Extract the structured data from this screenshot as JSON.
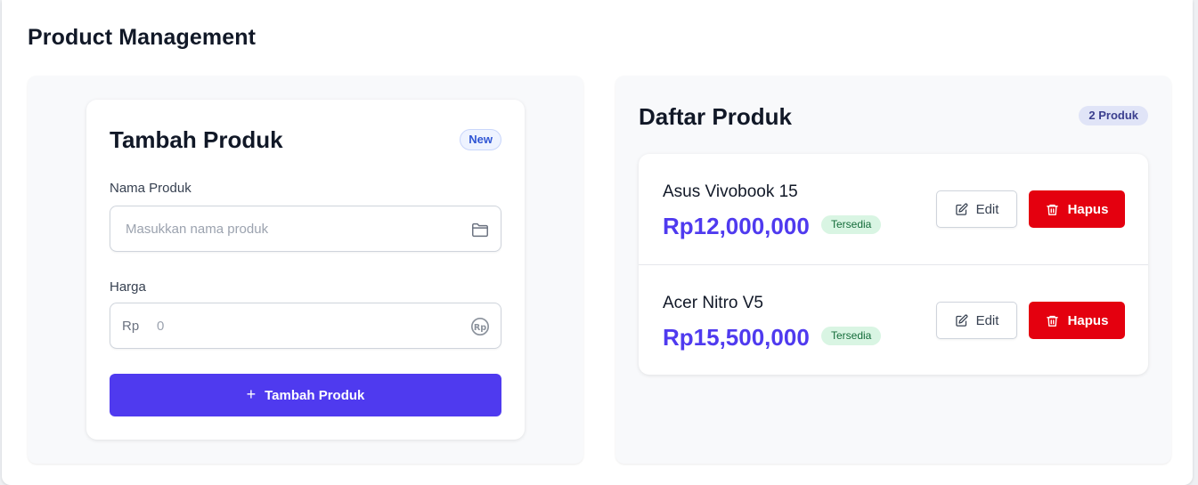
{
  "page": {
    "title": "Product Management"
  },
  "form": {
    "title": "Tambah Produk",
    "badge": "New",
    "name_label": "Nama Produk",
    "name_placeholder": "Masukkan nama produk",
    "name_value": "",
    "name_icon": "folder-icon",
    "price_label": "Harga",
    "price_prefix": "Rp",
    "price_placeholder": "0",
    "price_value": "",
    "price_icon": "rupiah-icon",
    "submit_label": "Tambah Produk",
    "submit_icon": "plus-icon"
  },
  "list": {
    "title": "Daftar Produk",
    "count_badge": "2 Produk",
    "items": [
      {
        "name": "Asus Vivobook 15",
        "price": "Rp12,000,000",
        "status": "Tersedia",
        "edit_label": "Edit",
        "delete_label": "Hapus"
      },
      {
        "name": "Acer Nitro V5",
        "price": "Rp15,500,000",
        "status": "Tersedia",
        "edit_label": "Edit",
        "delete_label": "Hapus"
      }
    ]
  },
  "colors": {
    "primary": "#4f3aef",
    "danger": "#e4000f",
    "status_bg": "#d9f5e3",
    "status_text": "#146c3a",
    "badge_new": "#2f55d4"
  }
}
